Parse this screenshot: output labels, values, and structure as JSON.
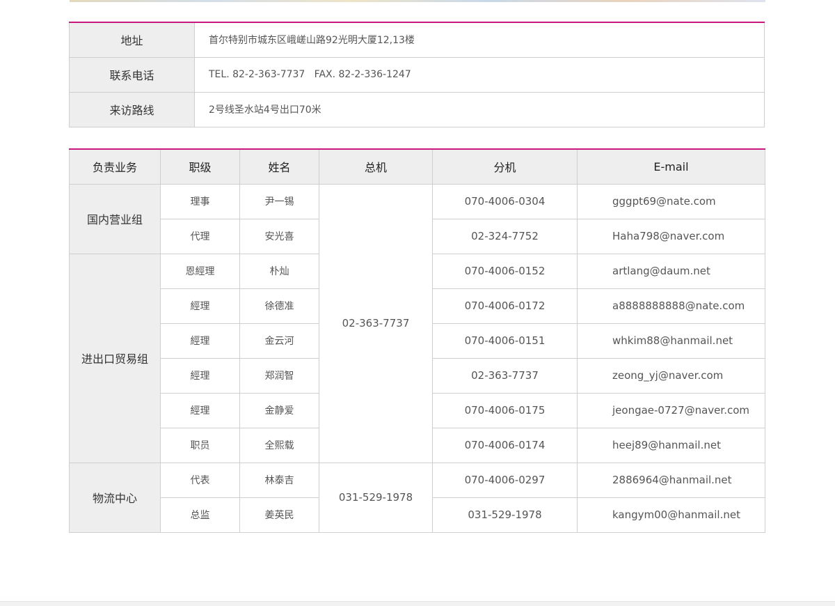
{
  "info": [
    {
      "label": "地址",
      "value": "首尔特别市城东区峨嵯山路92光明大厦12,13楼"
    },
    {
      "label": "联系电话",
      "value": "TEL. 82-2-363-7737   FAX. 82-2-336-1247"
    },
    {
      "label": "来访路线",
      "value": "2号线圣水站4号出口70米"
    }
  ],
  "staff_headers": [
    "负责业务",
    "职级",
    "姓名",
    "总机",
    "分机",
    "E-mail"
  ],
  "departments": [
    {
      "name": "国内营业组"
    },
    {
      "name": "进出口贸易组"
    },
    {
      "name": "物流中心"
    }
  ],
  "main_numbers": [
    "02-363-7737",
    "031-529-1978"
  ],
  "staff": [
    {
      "rank": "理事",
      "name": "尹一锡",
      "ext": "070-4006-0304",
      "email": "gggpt69@nate.com"
    },
    {
      "rank": "代理",
      "name": "安光喜",
      "ext": "02-324-7752",
      "email": "Haha798@naver.com"
    },
    {
      "rank": "恩經理",
      "name": "朴灿",
      "ext": "070-4006-0152",
      "email": "artlang@daum.net"
    },
    {
      "rank": "經理",
      "name": "徐德准",
      "ext": "070-4006-0172",
      "email": "a8888888888@nate.com"
    },
    {
      "rank": "經理",
      "name": "金云河",
      "ext": "070-4006-0151",
      "email": "whkim88@hanmail.net"
    },
    {
      "rank": "經理",
      "name": "郑润智",
      "ext": "02-363-7737",
      "email": "zeong_yj@naver.com"
    },
    {
      "rank": "經理",
      "name": "金静爱",
      "ext": "070-4006-0175",
      "email": "jeongae-0727@naver.com"
    },
    {
      "rank": "职员",
      "name": "全熙载",
      "ext": "070-4006-0174",
      "email": "heej89@hanmail.net"
    },
    {
      "rank": "代表",
      "name": "林泰吉",
      "ext": "070-4006-0297",
      "email": "2886964@hanmail.net"
    },
    {
      "rank": "总监",
      "name": "姜英民",
      "ext": "031-529-1978",
      "email": "kangym00@hanmail.net"
    }
  ],
  "colors": {
    "accent": "#c8187e",
    "header_bg": "#eeeeee",
    "border": "#cfcfcf"
  }
}
